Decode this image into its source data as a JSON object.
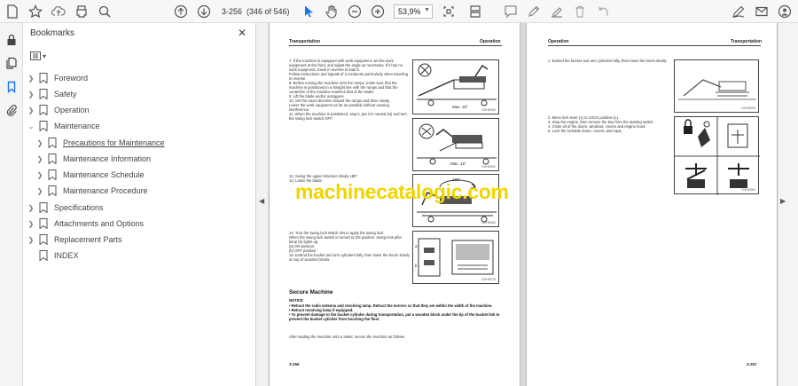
{
  "toolbar": {
    "current_page": "3-256",
    "page_count": "(346 of 546)",
    "zoom": "53,9%",
    "colors": {
      "accent": "#1a73e8"
    }
  },
  "bookmarks": {
    "title": "Bookmarks",
    "items": [
      {
        "label": "Foreword"
      },
      {
        "label": "Safety"
      },
      {
        "label": "Operation"
      },
      {
        "label": "Maintenance"
      },
      {
        "label": "Precautions for Maintenance"
      },
      {
        "label": "Maintenance Information"
      },
      {
        "label": "Maintenance Schedule"
      },
      {
        "label": "Maintenance Procedure"
      },
      {
        "label": "Specifications"
      },
      {
        "label": "Attachments and Options"
      },
      {
        "label": "Replacement Parts"
      },
      {
        "label": "INDEX"
      }
    ]
  },
  "left_page": {
    "header_left": "Transportation",
    "header_right": "Operation",
    "steps_a": [
      "7.   If the machine is equipped with work equipment, set the work equipment at the front, and adjust the angle as necessary. If it has no work equipment, travel in reverse to load it.",
      "      Follow instructions and signals of a conductor particularly when traveling in reverse.",
      "8.   Before moving the machine onto the ramps, make sure that the machine is positioned in a straight line with the ramps and that the centerline of the machine matches that of the trailer.",
      "9.   Lift the blade and/or outriggers.",
      "10. Set the travel direction toward the ramps and drive slowly.",
      "      Lower the work equipment as far as possible without causing interference.",
      "11. When the machine is positioned, stop it, put it in neutral (N) and turn the swing lock switch OFF."
    ],
    "steps_b": [
      "12. Swing the upper structure slowly 180°.",
      "13. Lower the blade."
    ],
    "steps_c": [
      "14. Turn the swing lock switch ON to apply the swing lock.",
      "      When the swing lock switch is turned to ON position, swing lock pilot lamp (6) lights up.",
      "      (a) ON position",
      "      (b) OFF position",
      "15. Extend the bucket and arm cylinders fully, then lower the boom slowly on top of wooden blocks."
    ],
    "fig1_label": "Max. 15°",
    "fig1_code": "GXHE060",
    "fig2_label": "Max. 15°",
    "fig2_code": "GXHE061",
    "fig3_label": "180°",
    "fig3_code": "GXHE062",
    "fig4_code": "GXHE076",
    "fig4_a": "a",
    "fig4_b": "b",
    "section_title": "Secure Machine",
    "notice_label": "NOTICE",
    "notices": [
      "•  Retract the radio antenna and revolving lamp. Retract the mirrors so that they are within the width of the machine.",
      "•  Retract revolving lamp if equipped.",
      "•  To prevent damage to the bucket cylinder during transportation, put a wooden block under the tip of the bucket link to prevent the bucket cylinder from touching the floor."
    ],
    "after_text": "After loading the machine onto a trailer, secure the machine as follows.",
    "page_number": "3-256"
  },
  "right_page": {
    "header_left": "Operation",
    "header_right": "Transportation",
    "steps_a": [
      "1.   Extend the bucket and arm cylinders fully, then lower the boom slowly."
    ],
    "steps_b": [
      "2.   Move lock lever (1) to LOCK position (L).",
      "3.   Stop the engine, then remove the key from the starting switch.",
      "4.   Close all of the doors, windows, covers and engine hood.",
      "5.   Lock the lockable doors, covers, and caps."
    ],
    "fig1_code": "GXHE063",
    "fig2_code": "GXHE064",
    "page_number": "3-257"
  },
  "watermark": "machinecatalogic.com"
}
